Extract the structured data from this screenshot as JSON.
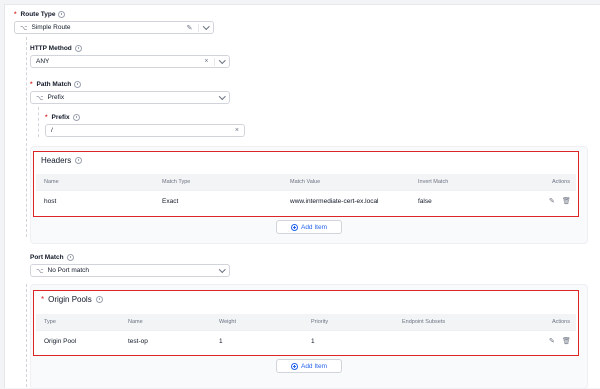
{
  "route_type": {
    "label": "Route Type",
    "required": true,
    "value": "Simple Route",
    "lead_icon": "route-icon"
  },
  "http_method": {
    "label": "HTTP Method",
    "value": "ANY"
  },
  "path_match": {
    "label": "Path Match",
    "required": true,
    "value": "Prefix"
  },
  "prefix": {
    "label": "Prefix",
    "required": true,
    "value": "/"
  },
  "headers": {
    "title": "Headers",
    "columns": [
      "Name",
      "Match Type",
      "Match Value",
      "Invert Match",
      "Actions"
    ],
    "rows": [
      {
        "name": "host",
        "match_type": "Exact",
        "match_value": "www.intermediate-cert-ex.local",
        "invert_match": "false"
      }
    ],
    "add_label": "Add Item"
  },
  "port_match": {
    "label": "Port Match",
    "value": "No Port match"
  },
  "origin_pools": {
    "title": "Origin Pools",
    "required": true,
    "columns": [
      "Type",
      "Name",
      "Weight",
      "Priority",
      "Endpoint Subsets",
      "Actions"
    ],
    "rows": [
      {
        "type": "Origin Pool",
        "name": "test-op",
        "weight": "1",
        "priority": "1",
        "endpoint_subsets": ""
      }
    ],
    "add_label": "Add Item"
  },
  "colors": {
    "accent": "#2563eb",
    "highlight": "#dc2626",
    "required": "#dc2626"
  }
}
